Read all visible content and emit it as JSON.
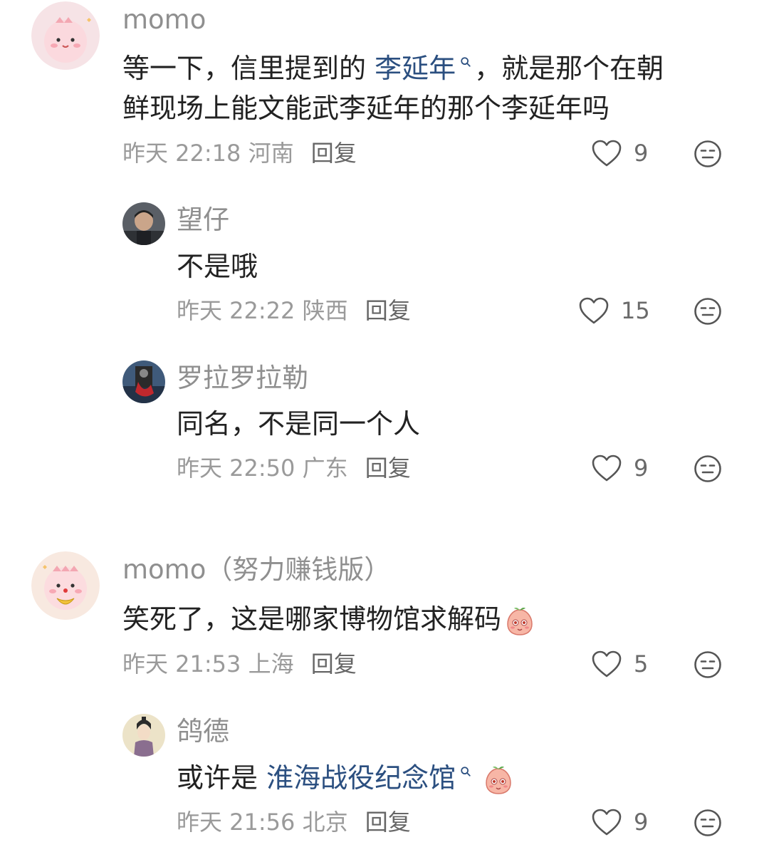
{
  "comments": [
    {
      "author": "momo",
      "text_parts": [
        "等一下，信里提到的 ",
        "李延年",
        "，就是那个在朝"
      ],
      "text_line2": "鲜现场上能文能武李延年的那个李延年吗",
      "time": "昨天 22:18",
      "location": "河南",
      "reply_label": "回复",
      "likes": "9"
    },
    {
      "author": "望仔",
      "text": "不是哦",
      "time": "昨天 22:22",
      "location": "陕西",
      "reply_label": "回复",
      "likes": "15"
    },
    {
      "author": "罗拉罗拉勒",
      "text": "同名，不是同一个人",
      "time": "昨天 22:50",
      "location": "广东",
      "reply_label": "回复",
      "likes": "9"
    },
    {
      "author": "momo（努力赚钱版）",
      "text": "笑死了，这是哪家博物馆求解码",
      "time": "昨天 21:53",
      "location": "上海",
      "reply_label": "回复",
      "likes": "5"
    },
    {
      "author": "鸽德",
      "text_prefix": "或许是 ",
      "text_link": "淮海战役纪念馆",
      "time": "昨天 21:56",
      "location": "北京",
      "reply_label": "回复",
      "likes": "9"
    }
  ],
  "icons": {
    "like": "heart-outline-icon",
    "dislike": "neutral-face-icon",
    "search_mark": "search-icon",
    "emoji": "peach-emoji"
  },
  "colors": {
    "link": "#2b4f80",
    "meta": "#9a9a9a",
    "name": "#8f8f8f"
  }
}
